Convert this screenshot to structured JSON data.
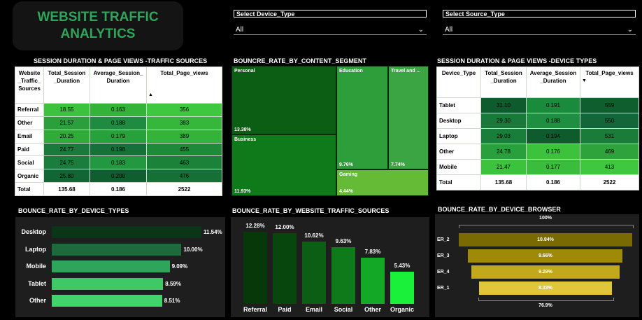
{
  "title": "WEBSITE TRAFFIC ANALYTICS",
  "slicers": [
    {
      "label": "Select Device_Type",
      "value": "All"
    },
    {
      "label": "Select Source_Type",
      "value": "All"
    }
  ],
  "table_sources": {
    "title": "SESSION DURATION & PAGE VIEWS -TRAFFIC SOURCES",
    "headers": [
      "Website _Traffic_ Sources",
      "Total_Session _Duration",
      "Average_Session_ Duration",
      "Total_Page_views"
    ],
    "rows": [
      {
        "name": "Referral",
        "total": "18.55",
        "avg": "0.163",
        "views": "356"
      },
      {
        "name": "Other",
        "total": "21.57",
        "avg": "0.188",
        "views": "383"
      },
      {
        "name": "Email",
        "total": "20.25",
        "avg": "0.179",
        "views": "389"
      },
      {
        "name": "Paid",
        "total": "24.77",
        "avg": "0.198",
        "views": "455"
      },
      {
        "name": "Social",
        "total": "24.75",
        "avg": "0.183",
        "views": "463"
      },
      {
        "name": "Organic",
        "total": "25.80",
        "avg": "0.200",
        "views": "476"
      }
    ],
    "total": {
      "name": "Total",
      "total": "135.68",
      "avg": "0.186",
      "views": "2522"
    }
  },
  "treemap": {
    "title": "BOUNCRE_RATE_BY_CONTENT_SEGMENT",
    "cells": [
      {
        "name": "Personal",
        "value": "13.38%",
        "color": "#0d5e15"
      },
      {
        "name": "Business",
        "value": "11.93%",
        "color": "#0f7a1a"
      },
      {
        "name": "Education",
        "value": "9.76%",
        "color": "#2e9e3a"
      },
      {
        "name": "Travel and ...",
        "value": "7.74%",
        "color": "#3aa542"
      },
      {
        "name": "Gaming",
        "value": "4.44%",
        "color": "#65bb35"
      }
    ]
  },
  "table_devices": {
    "title": "SESSION DURATION & PAGE VIEWS -DEVICE TYPES",
    "headers": [
      "Device_Type",
      "Total_Session _Duration",
      "Average_Session _Duration",
      "Total_Page_views"
    ],
    "rows": [
      {
        "name": "Tablet",
        "total": "31.10",
        "avg": "0.191",
        "views": "559"
      },
      {
        "name": "Desktop",
        "total": "29.30",
        "avg": "0.188",
        "views": "550"
      },
      {
        "name": "Laptop",
        "total": "29.03",
        "avg": "0.194",
        "views": "531"
      },
      {
        "name": "Other",
        "total": "24.78",
        "avg": "0.176",
        "views": "469"
      },
      {
        "name": "Mobile",
        "total": "21.47",
        "avg": "0.177",
        "views": "413"
      }
    ],
    "total": {
      "name": "Total",
      "total": "135.68",
      "avg": "0.186",
      "views": "2522"
    }
  },
  "chart_data": [
    {
      "type": "bar",
      "orientation": "horizontal",
      "title": "BOUNCE_RATE_BY_DEVICE_TYPES",
      "categories": [
        "Desktop",
        "Laptop",
        "Mobile",
        "Tablet",
        "Other"
      ],
      "values": [
        11.54,
        10.0,
        9.09,
        8.59,
        8.51
      ],
      "labels": [
        "11.54%",
        "10.00%",
        "9.09%",
        "8.59%",
        "8.51%"
      ],
      "colors": [
        "#0a3517",
        "#1e6a3d",
        "#2fa55b",
        "#3fc868",
        "#42d46c"
      ]
    },
    {
      "type": "bar",
      "title": "BOUNCE_RATE_BY_WEBSITE_TRAFFIC_SOURCES",
      "categories": [
        "Referral",
        "Paid",
        "Email",
        "Social",
        "Other",
        "Organic"
      ],
      "values": [
        12.28,
        12.0,
        10.62,
        9.63,
        7.83,
        5.43
      ],
      "labels": [
        "12.28%",
        "12.00%",
        "10.62%",
        "9.63%",
        "7.83%",
        "5.43%"
      ],
      "colors": [
        "#06380a",
        "#07470d",
        "#0b5e14",
        "#0f7a1a",
        "#13a826",
        "#1af03a"
      ]
    },
    {
      "type": "funnel",
      "title": "BOUNCE_RATE_BY_DEVICE_BROWSER",
      "categories": [
        "ER_2",
        "ER_3",
        "ER_4",
        "ER_1"
      ],
      "values": [
        10.84,
        9.66,
        9.29,
        8.33
      ],
      "labels": [
        "10.84%",
        "9.66%",
        "9.29%",
        "8.33%"
      ],
      "top_label": "100%",
      "bottom_label": "76.9%",
      "colors": [
        "#7a6a04",
        "#9e8a08",
        "#c2a81c",
        "#e2c63a"
      ]
    }
  ]
}
